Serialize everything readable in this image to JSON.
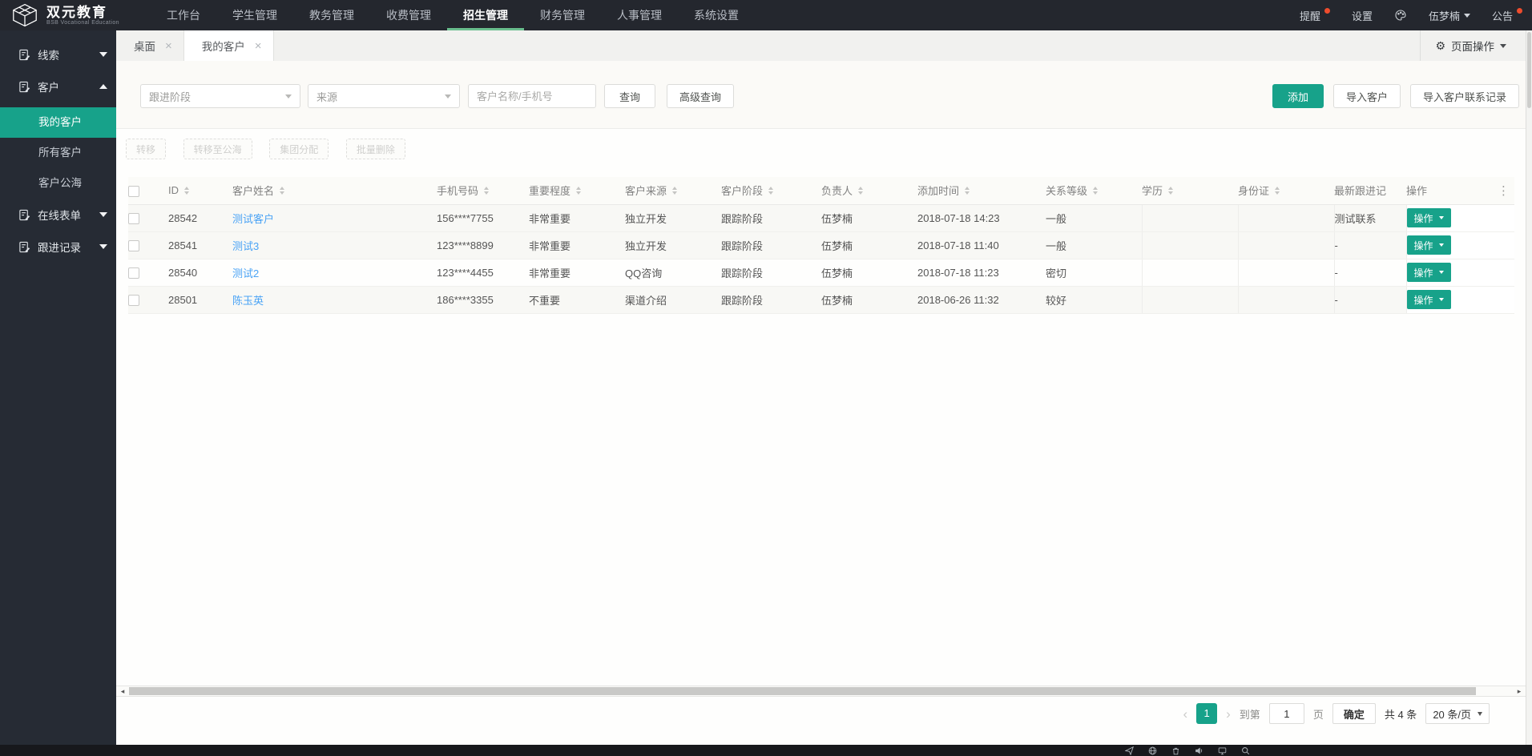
{
  "topbar": {
    "logo_title": "双元教育",
    "logo_subtitle": "BSB Vocational Education",
    "menu": [
      {
        "label": "工作台",
        "active": false
      },
      {
        "label": "学生管理",
        "active": false
      },
      {
        "label": "教务管理",
        "active": false
      },
      {
        "label": "收费管理",
        "active": false
      },
      {
        "label": "招生管理",
        "active": true
      },
      {
        "label": "财务管理",
        "active": false
      },
      {
        "label": "人事管理",
        "active": false
      },
      {
        "label": "系统设置",
        "active": false
      }
    ],
    "alerts_label": "提醒",
    "settings_label": "设置",
    "user_name": "伍梦楠",
    "notice_label": "公告"
  },
  "sidebar": {
    "items": [
      {
        "label": "线索",
        "type": "group",
        "expanded": false
      },
      {
        "label": "客户",
        "type": "group",
        "expanded": true
      },
      {
        "label": "我的客户",
        "type": "sub",
        "active": true
      },
      {
        "label": "所有客户",
        "type": "sub",
        "active": false
      },
      {
        "label": "客户公海",
        "type": "sub",
        "active": false
      },
      {
        "label": "在线表单",
        "type": "group",
        "expanded": false
      },
      {
        "label": "跟进记录",
        "type": "group",
        "expanded": false
      }
    ]
  },
  "tabbar": {
    "tabs": [
      {
        "label": "桌面",
        "close": "×",
        "active": false
      },
      {
        "label": "我的客户",
        "close": "×",
        "active": true
      }
    ],
    "page_ops_label": "页面操作"
  },
  "toolbar": {
    "stage_filter": "跟进阶段",
    "source_filter": "来源",
    "search_placeholder": "客户名称/手机号",
    "query_label": "查询",
    "advanced_query_label": "高级查询",
    "add_label": "添加",
    "import_customers_label": "导入客户",
    "import_contact_records_label": "导入客户联系记录",
    "bulk_actions": [
      {
        "label": "转移"
      },
      {
        "label": "转移至公海"
      },
      {
        "label": "集团分配"
      },
      {
        "label": "批量删除"
      }
    ]
  },
  "table": {
    "columns": [
      {
        "label": "ID",
        "sortable": true
      },
      {
        "label": "客户姓名",
        "sortable": true
      },
      {
        "label": "手机号码",
        "sortable": true
      },
      {
        "label": "重要程度",
        "sortable": true
      },
      {
        "label": "客户来源",
        "sortable": true
      },
      {
        "label": "客户阶段",
        "sortable": true
      },
      {
        "label": "负责人",
        "sortable": true
      },
      {
        "label": "添加时间",
        "sortable": true
      },
      {
        "label": "关系等级",
        "sortable": true
      },
      {
        "label": "学历",
        "sortable": true
      },
      {
        "label": "身份证",
        "sortable": true
      },
      {
        "label": "最新跟进记",
        "sortable": false
      },
      {
        "label": "操作",
        "sortable": false
      }
    ],
    "rows": [
      {
        "id": "28542",
        "name": "测试客户",
        "phone": "156****7755",
        "importance": "非常重要",
        "source": "独立开发",
        "stage": "跟踪阶段",
        "owner": "伍梦楠",
        "added_time": "2018-07-18 14:23",
        "relation": "一般",
        "education": "",
        "id_card": "",
        "latest_follow": "测试联系",
        "action_label": "操作"
      },
      {
        "id": "28541",
        "name": "测试3",
        "phone": "123****8899",
        "importance": "非常重要",
        "source": "独立开发",
        "stage": "跟踪阶段",
        "owner": "伍梦楠",
        "added_time": "2018-07-18 11:40",
        "relation": "一般",
        "education": "",
        "id_card": "",
        "latest_follow": "-",
        "action_label": "操作"
      },
      {
        "id": "28540",
        "name": "测试2",
        "phone": "123****4455",
        "importance": "非常重要",
        "source": "QQ咨询",
        "stage": "跟踪阶段",
        "owner": "伍梦楠",
        "added_time": "2018-07-18 11:23",
        "relation": "密切",
        "education": "",
        "id_card": "",
        "latest_follow": "-",
        "action_label": "操作"
      },
      {
        "id": "28501",
        "name": "陈玉英",
        "phone": "186****3355",
        "importance": "不重要",
        "source": "渠道介绍",
        "stage": "跟踪阶段",
        "owner": "伍梦楠",
        "added_time": "2018-06-26 11:32",
        "relation": "较好",
        "education": "",
        "id_card": "",
        "latest_follow": "-",
        "action_label": "操作"
      }
    ]
  },
  "pagination": {
    "prev": "‹",
    "current_page": "1",
    "next": "›",
    "goto_prefix": "到第",
    "goto_value": "1",
    "goto_suffix": "页",
    "confirm_label": "确定",
    "total_label": "共 4 条",
    "page_size": "20 条/页"
  },
  "colors": {
    "accent_teal": "#17a28a",
    "nav_underline_green": "#6abe8e",
    "link_blue": "#4aa3f5",
    "alert_dot_red": "#ee4c2d"
  }
}
